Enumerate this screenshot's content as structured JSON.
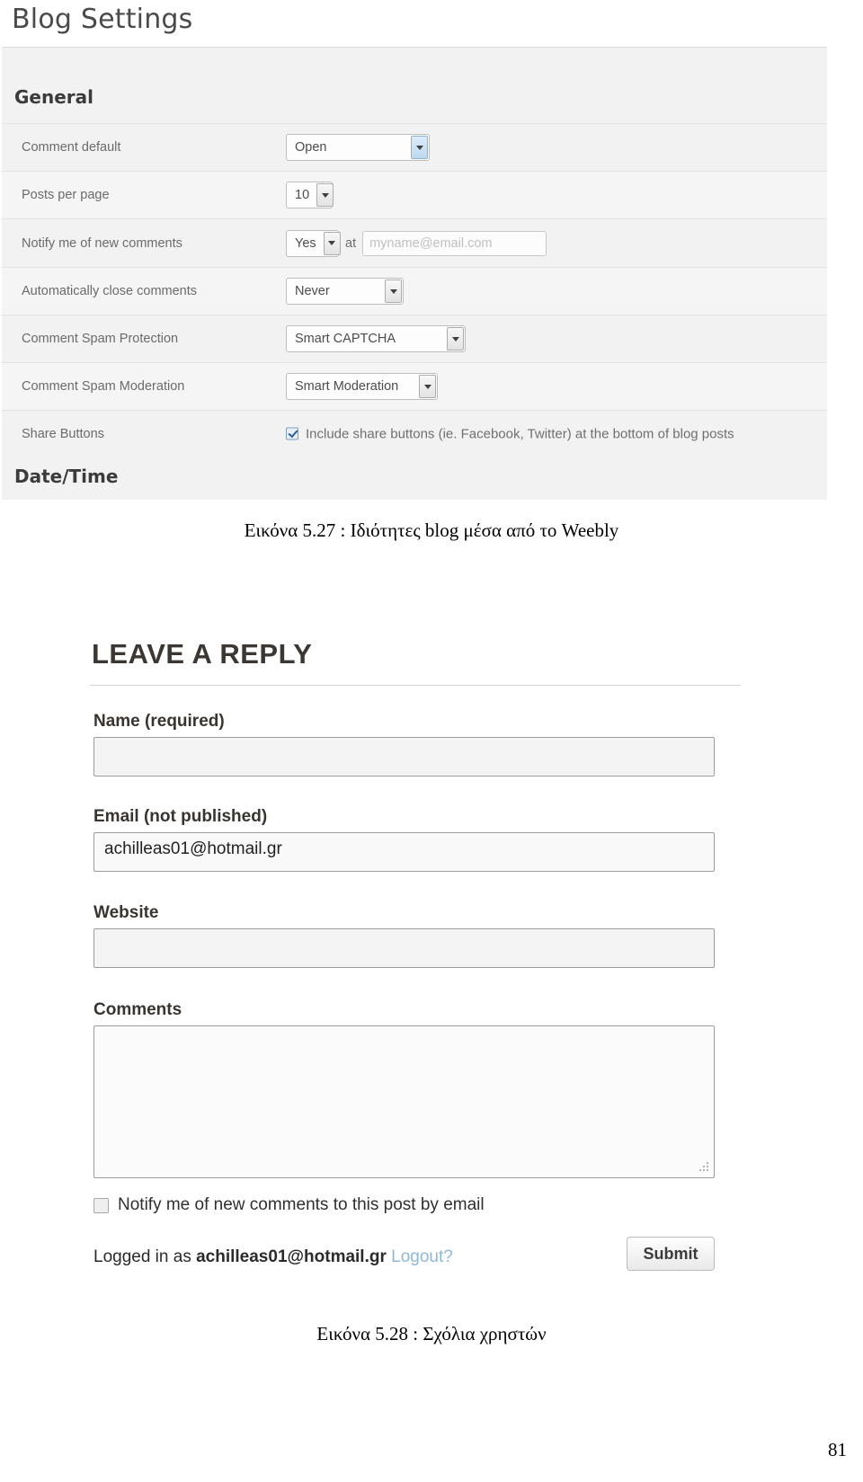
{
  "figure_blog_settings": {
    "window_title": "Blog Settings",
    "sections": {
      "general": "General",
      "datetime": "Date/Time"
    },
    "rows": [
      {
        "label": "Comment default",
        "value": "Open",
        "control": "select"
      },
      {
        "label": "Posts per page",
        "value": "10",
        "control": "select"
      },
      {
        "label": "Notify me of new comments",
        "value": "Yes",
        "control": "select-with-email",
        "at_word": "at",
        "email_placeholder": "myname@email.com"
      },
      {
        "label": "Automatically close comments",
        "value": "Never",
        "control": "select"
      },
      {
        "label": "Comment Spam Protection",
        "value": "Smart CAPTCHA",
        "control": "select"
      },
      {
        "label": "Comment Spam Moderation",
        "value": "Smart Moderation",
        "control": "select"
      },
      {
        "label": "Share Buttons",
        "checkbox_label": "Include share buttons (ie. Facebook, Twitter) at the bottom of blog posts",
        "control": "checkbox",
        "checked": true
      }
    ]
  },
  "caption_1": "Εικόνα 5.27 : Ιδιότητες blog μέσα από το Weebly",
  "figure_leave_reply": {
    "heading": "LEAVE A REPLY",
    "fields": [
      {
        "label": "Name (required)",
        "value": ""
      },
      {
        "label": "Email (not published)",
        "value": "achilleas01@hotmail.gr"
      },
      {
        "label": "Website",
        "value": ""
      },
      {
        "label": "Comments",
        "value": ""
      }
    ],
    "notify_checkbox_label": "Notify me of new comments to this post by email",
    "logged_in_prefix": "Logged in as ",
    "logged_in_user": "achilleas01@hotmail.gr",
    "logout_label": " Logout?",
    "submit_label": "Submit"
  },
  "caption_2": "Εικόνα 5.28 : Σχόλια χρηστών",
  "page_number": "81"
}
